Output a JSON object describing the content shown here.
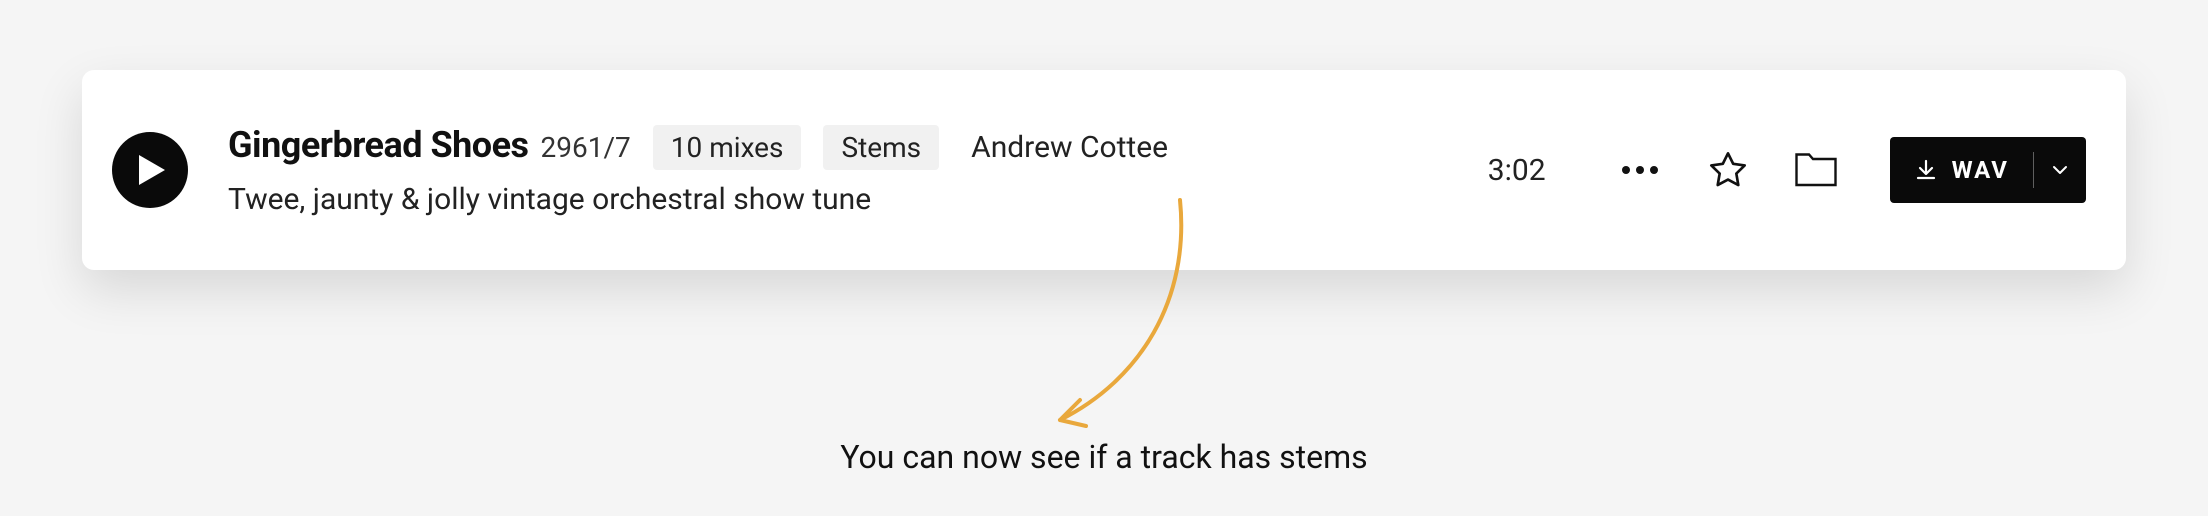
{
  "track": {
    "title": "Gingerbread Shoes",
    "code": "2961/7",
    "mixes_label": "10 mixes",
    "stems_label": "Stems",
    "artist": "Andrew Cottee",
    "description": "Twee, jaunty & jolly vintage orchestral show tune",
    "duration": "3:02"
  },
  "download": {
    "format_label": "WAV"
  },
  "annotation": {
    "text": "You can now see if a track has stems"
  },
  "colors": {
    "accent_arrow": "#e9a83c"
  }
}
